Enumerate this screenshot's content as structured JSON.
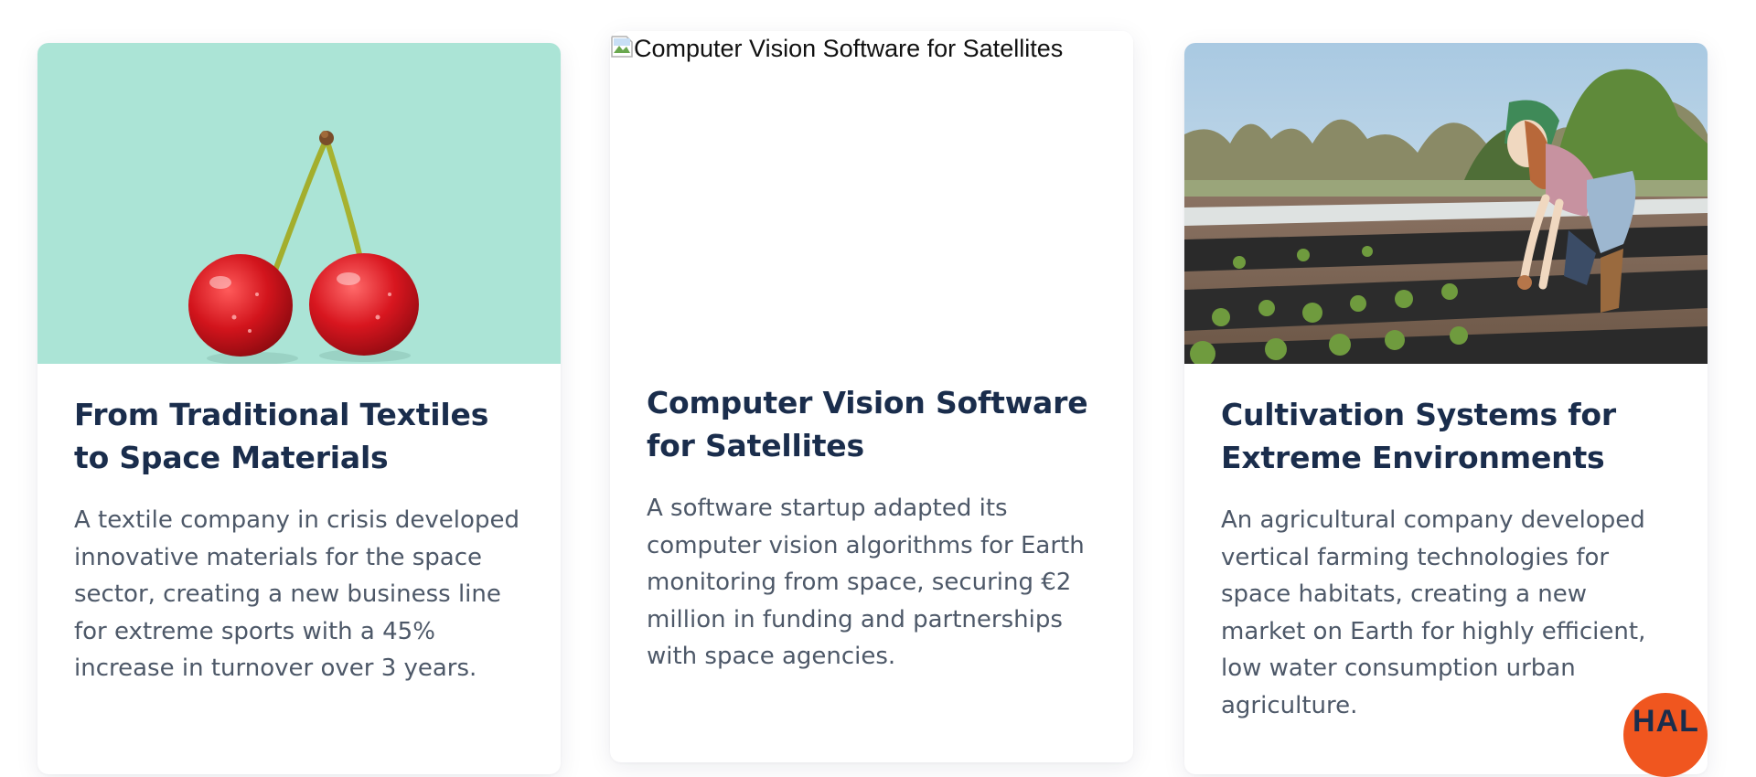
{
  "cards": [
    {
      "image_alt": "",
      "title": "From Traditional Textiles to Space Materials",
      "description": "A textile company in crisis developed innovative materials for the space sector, creating a new business line for extreme sports with a 45% increase in turnover over 3 years."
    },
    {
      "image_alt": "Computer Vision Software for Satellites",
      "title": "Computer Vision Software for Satellites",
      "description": "A software startup adapted its computer vision algorithms for Earth monitoring from space, securing €2 million in funding and partnerships with space agencies."
    },
    {
      "image_alt": "",
      "title": "Cultivation Systems for Extreme Environments",
      "description": "An agricultural company developed vertical farming technologies for space habitats, creating a new market on Earth for highly efficient, low water consumption urban agriculture."
    }
  ],
  "chat_widget": {
    "label": "HAL"
  },
  "colors": {
    "title": "#1a2d4c",
    "text": "#4d5868",
    "cherry_background": "#abe4d6",
    "accent": "#f0561f"
  },
  "icons": [
    "cherries-photo",
    "broken-image-icon",
    "farmer-field-photo"
  ]
}
